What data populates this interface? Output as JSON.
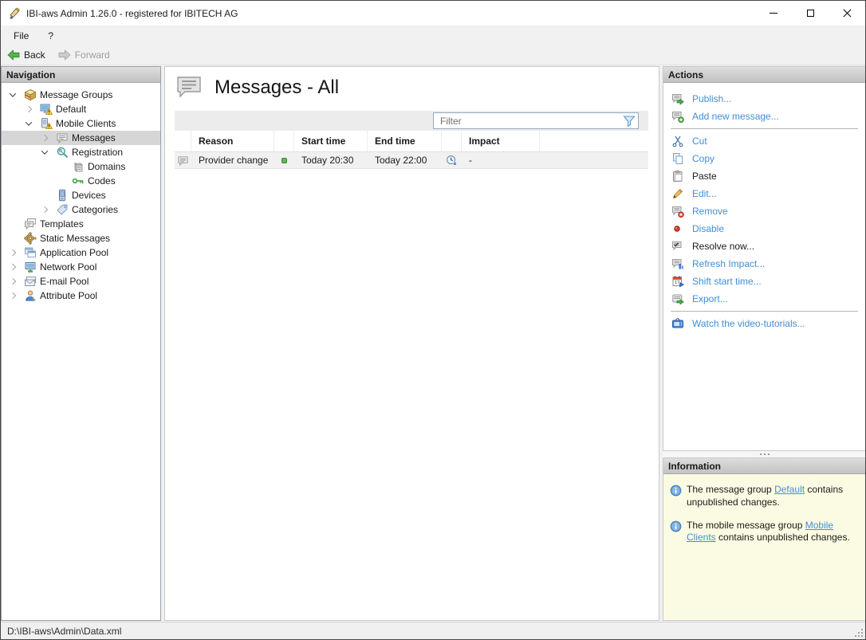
{
  "window": {
    "title": "IBI-aws Admin 1.26.0 - registered for IBITECH AG"
  },
  "menu": {
    "file": "File",
    "help": "?"
  },
  "toolbar": {
    "back": "Back",
    "forward": "Forward"
  },
  "navigation": {
    "header": "Navigation",
    "items": [
      {
        "label": "Message Groups"
      },
      {
        "label": "Default"
      },
      {
        "label": "Mobile Clients"
      },
      {
        "label": "Messages"
      },
      {
        "label": "Registration"
      },
      {
        "label": "Domains"
      },
      {
        "label": "Codes"
      },
      {
        "label": "Devices"
      },
      {
        "label": "Categories"
      },
      {
        "label": "Templates"
      },
      {
        "label": "Static Messages"
      },
      {
        "label": "Application Pool"
      },
      {
        "label": "Network Pool"
      },
      {
        "label": "E-mail Pool"
      },
      {
        "label": "Attribute Pool"
      }
    ]
  },
  "main": {
    "title": "Messages - All",
    "filter": {
      "placeholder": "Filter"
    },
    "table": {
      "columns": {
        "reason": "Reason",
        "start": "Start time",
        "end": "End time",
        "impact": "Impact"
      },
      "rows": [
        {
          "reason": "Provider change",
          "status": "green",
          "start": "Today 20:30",
          "end": "Today 22:00",
          "impact": "-"
        }
      ]
    }
  },
  "actions": {
    "header": "Actions",
    "items": [
      {
        "label": "Publish..."
      },
      {
        "label": "Add new message..."
      },
      {
        "label": "Cut"
      },
      {
        "label": "Copy"
      },
      {
        "label": "Paste"
      },
      {
        "label": "Edit..."
      },
      {
        "label": "Remove"
      },
      {
        "label": "Disable"
      },
      {
        "label": "Resolve now..."
      },
      {
        "label": "Refresh Impact..."
      },
      {
        "label": "Shift start time..."
      },
      {
        "label": "Export..."
      },
      {
        "label": "Watch the video-tutorials..."
      }
    ]
  },
  "information": {
    "header": "Information",
    "items": [
      {
        "prefix": "The message group ",
        "link": "Default",
        "suffix": " contains unpublished changes."
      },
      {
        "prefix": "The mobile message group ",
        "link": "Mobile Clients",
        "suffix": " contains unpublished changes."
      }
    ]
  },
  "statusbar": {
    "path": "D:\\IBI-aws\\Admin\\Data.xml"
  },
  "colors": {
    "action_link": "#3f8fd6",
    "info_background": "#fbfbe3",
    "status_green": "#5cb854",
    "disable_red": "#e04030"
  }
}
